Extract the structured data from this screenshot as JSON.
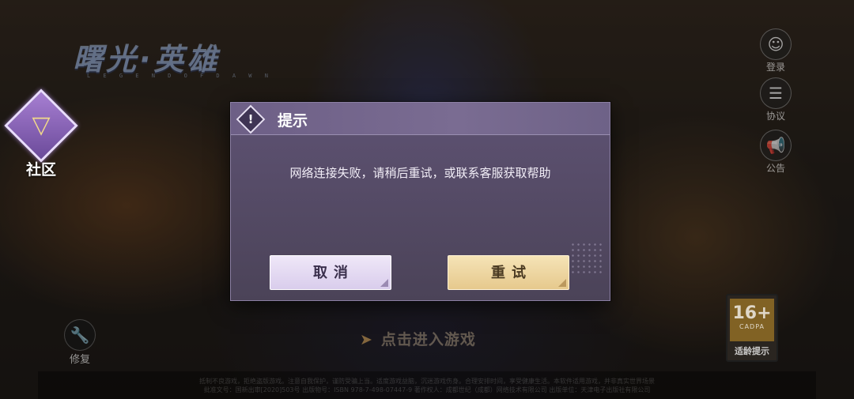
{
  "background": {
    "logo_text": "曙光·英雄",
    "logo_sub": "L E G E N D   O F   D A W N",
    "community_label": "社区",
    "side_buttons": [
      {
        "icon": "user-icon",
        "glyph": "☺",
        "label": "登录"
      },
      {
        "icon": "document-icon",
        "glyph": "☰",
        "label": "协议"
      },
      {
        "icon": "megaphone-icon",
        "glyph": "📢",
        "label": "公告"
      }
    ],
    "repair_label": "修复",
    "enter_game_label": "点击进入游戏",
    "age_rating": {
      "number": "16+",
      "org": "CADPA",
      "label": "适龄提示"
    },
    "footer_lines": [
      "抵制不良游戏，拒绝盗版游戏。注意自我保护，谨防受骗上当。适度游戏益脑，沉迷游戏伤身。合理安排时间，享受健康生活。本软件适用游戏，并非真实世界场景",
      "批准文号：国新出审[2020]503号  出版物号：ISBN 978-7-498-07447-9  著作权人：成都世纪（成都）网络技术有限公司  出版单位：天津电子出版社有限公司"
    ]
  },
  "dialog": {
    "title": "提示",
    "warn_glyph": "!",
    "message": "网络连接失败，请稍后重试，或联系客服获取帮助",
    "cancel_label": "取消",
    "retry_label": "重试"
  },
  "colors": {
    "dialog_bg": "#5e5273",
    "cancel_bg": "#e6dcf3",
    "retry_bg": "#efd6a0",
    "community_accent": "#a77fd2"
  }
}
